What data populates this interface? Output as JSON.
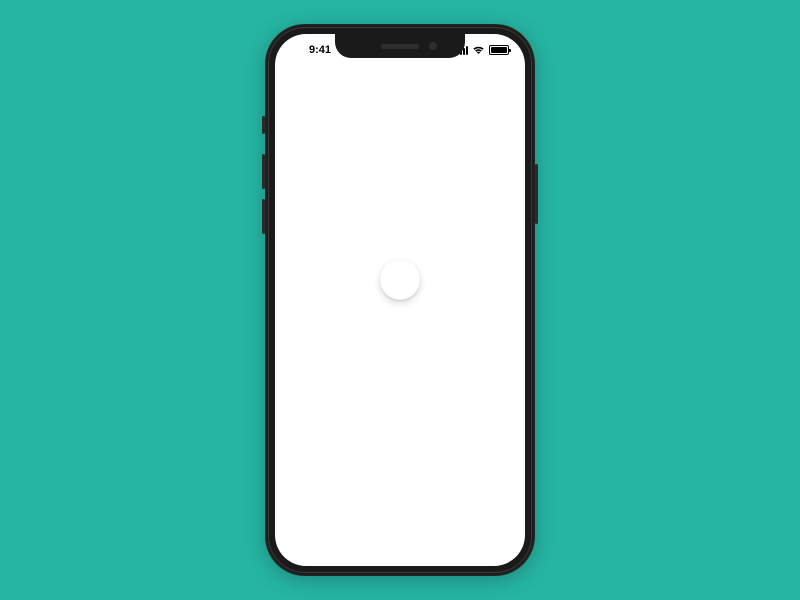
{
  "status_bar": {
    "time": "9:41"
  },
  "colors": {
    "background": "#26b5a3",
    "screen": "#ffffff",
    "frame": "#1a1a1a"
  }
}
